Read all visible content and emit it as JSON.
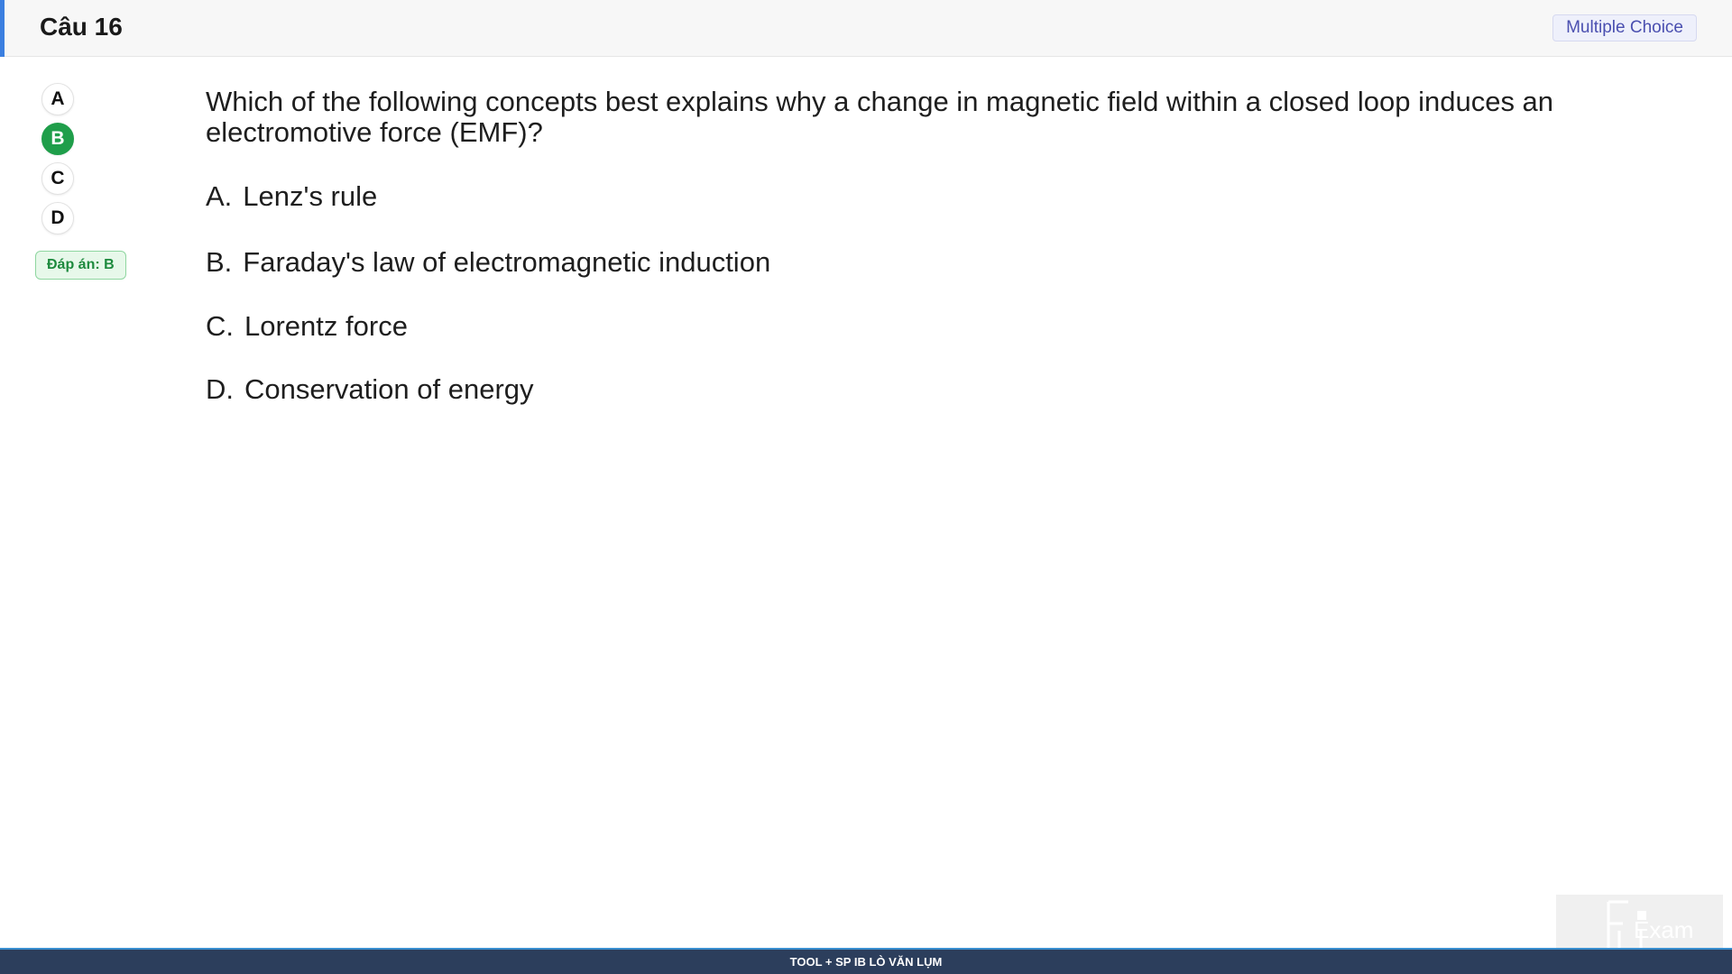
{
  "header": {
    "title": "Câu 16",
    "question_type": "Multiple Choice"
  },
  "answer_options": [
    {
      "label": "A",
      "selected": false
    },
    {
      "label": "B",
      "selected": true
    },
    {
      "label": "C",
      "selected": false
    },
    {
      "label": "D",
      "selected": false
    }
  ],
  "answer_badge": "Đáp án: B",
  "question": {
    "text": "Which of the following concepts best explains why a change in magnetic field within a closed loop induces an electromotive force (EMF)?",
    "choices": [
      {
        "letter": "A.",
        "text": "Lenz's rule"
      },
      {
        "letter": "B.",
        "text": "Faraday's law of electromagnetic induction"
      },
      {
        "letter": "C.",
        "text": "Lorentz force"
      },
      {
        "letter": "D.",
        "text": "Conservation of energy"
      }
    ]
  },
  "logo": {
    "text": "Exam",
    "icon": "fu-exam-logo"
  },
  "footer": {
    "credit": "TOOL + SP IB LÒ VĂN LỤM"
  },
  "colors": {
    "accent": "#3b7fe0",
    "selected_green": "#1f9e4a",
    "badge_purple": "#4a4fb0",
    "footer_bg": "#2c3e5c"
  }
}
